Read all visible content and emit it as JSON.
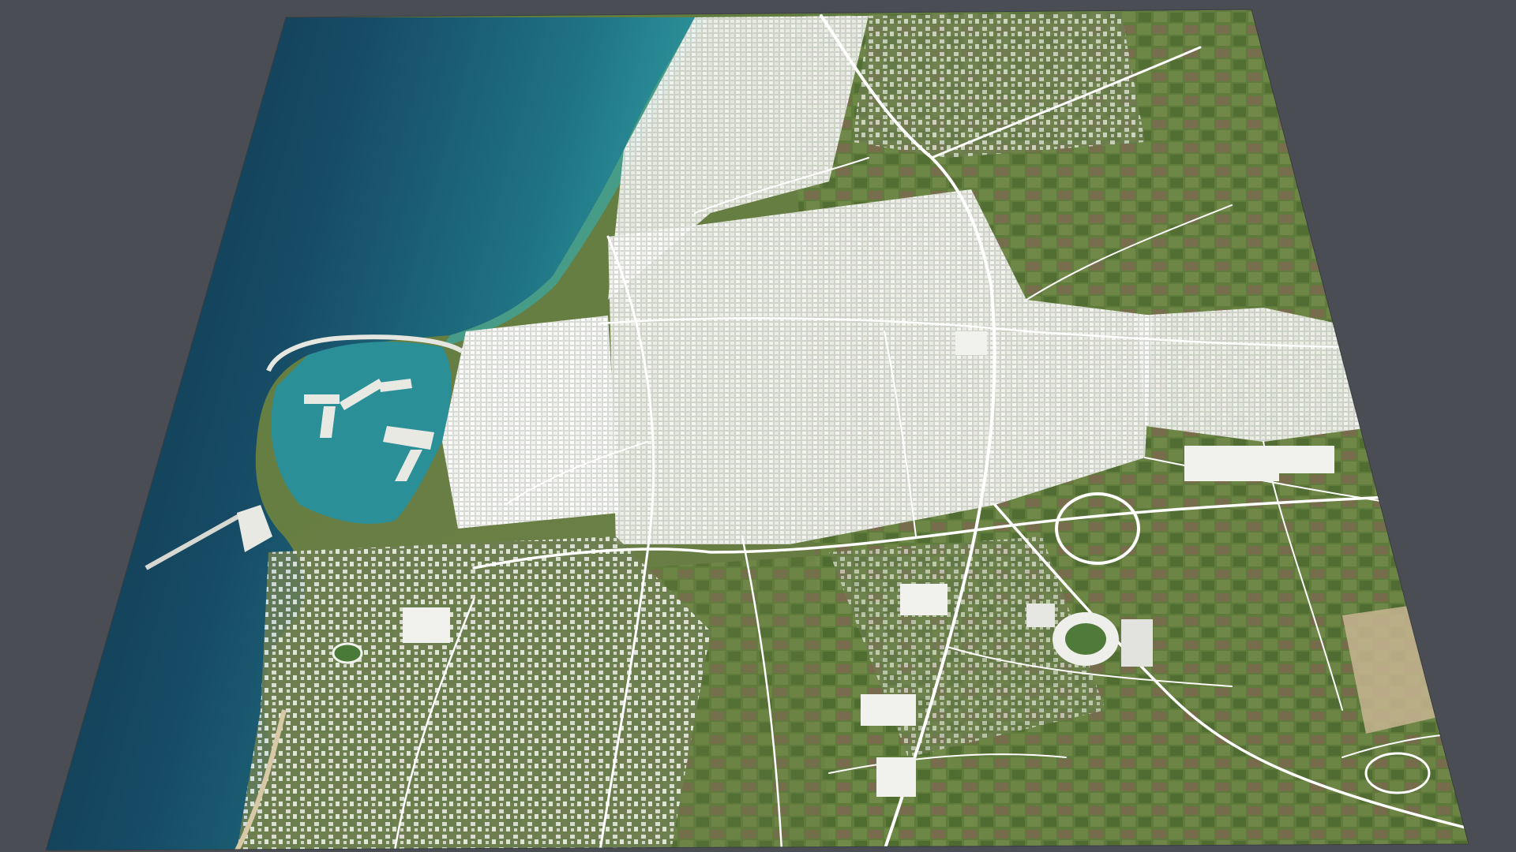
{
  "scene": {
    "kind": "3d-city-map-render",
    "background_color": "#4a4e54",
    "sea_deep_color": "#123a52",
    "sea_mid_color": "#1d6a7e",
    "sea_shallow_color": "#2ea0a8",
    "land_color": "#5f7a3e",
    "field_color_a": "#6f8a45",
    "field_color_b": "#7a6a4e",
    "field_color_c": "#4f6d32",
    "building_color": "#f3f3f0",
    "road_color": "#ffffff",
    "stadium_color": "#e9e9e6",
    "quarry_color": "#c9b79a"
  },
  "layers": [
    {
      "name": "sea"
    },
    {
      "name": "coastline"
    },
    {
      "name": "farmland"
    },
    {
      "name": "urban-blocks"
    },
    {
      "name": "road-network"
    },
    {
      "name": "harbor"
    },
    {
      "name": "stadium"
    },
    {
      "name": "roundabout"
    }
  ]
}
